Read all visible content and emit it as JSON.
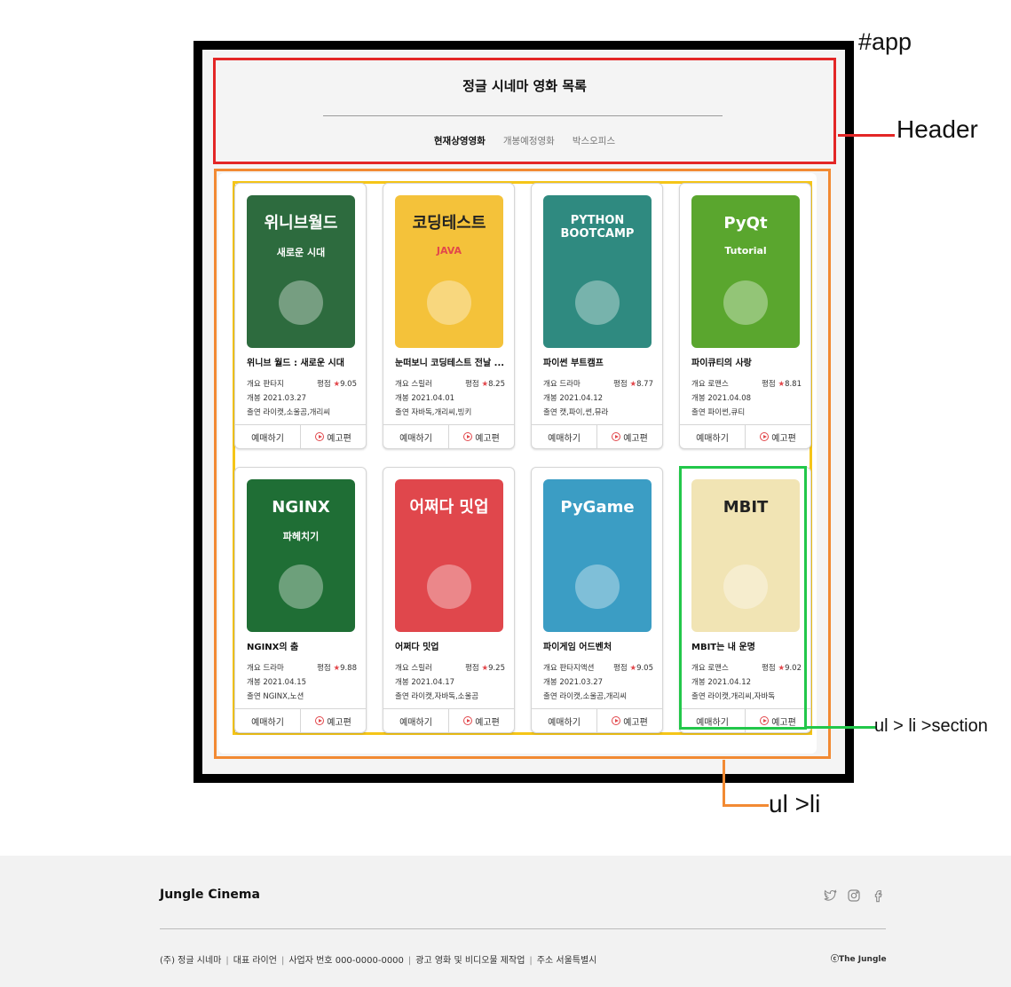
{
  "annotations": {
    "app_label": "#app",
    "header_label": "Header",
    "li_label": "ul >li",
    "section_label": "ul > li >section"
  },
  "header": {
    "title": "정글 시네마 영화 목록",
    "tabs": [
      {
        "label": "현재상영영화",
        "active": true
      },
      {
        "label": "개봉예정영화",
        "active": false
      },
      {
        "label": "박스오피스",
        "active": false
      }
    ]
  },
  "labels": {
    "genre": "개요",
    "rating": "평점",
    "release": "개봉",
    "cast": "출연",
    "reserve_button": "예매하기",
    "trailer_button": "예고편",
    "star": "★"
  },
  "movies": [
    {
      "title": "위니브 월드 : 새로운 시대",
      "genre": "판타지",
      "rating": "9.05",
      "release": "2021.03.27",
      "cast": "라이캣,소울곰,개리씨",
      "poster_text": "위니브월드",
      "poster_sub": "새로운 시대",
      "poster_color": "#2d6b3e"
    },
    {
      "title": "눈떠보니 코딩테스트 전날 ...",
      "genre": "스릴러",
      "rating": "8.25",
      "release": "2021.04.01",
      "cast": "자바독,개리씨,빙키",
      "poster_text": "코딩테스트",
      "poster_sub": "JAVA",
      "poster_color": "#f4c23a"
    },
    {
      "title": "파이썬 부트캠프",
      "genre": "드라마",
      "rating": "8.77",
      "release": "2021.04.12",
      "cast": "캣,파이,썬,뮤라",
      "poster_text": "PYTHON BOOTCAMP",
      "poster_sub": "",
      "poster_color": "#2f8a80"
    },
    {
      "title": "파이큐티의 사랑",
      "genre": "로맨스",
      "rating": "8.81",
      "release": "2021.04.08",
      "cast": "파이썬,큐티",
      "poster_text": "PyQt",
      "poster_sub": "Tutorial",
      "poster_color": "#5aa62e"
    },
    {
      "title": "NGINX의 춤",
      "genre": "드라마",
      "rating": "9.88",
      "release": "2021.04.15",
      "cast": "NGINX,노션",
      "poster_text": "NGINX",
      "poster_sub": "파헤치기",
      "poster_color": "#1f6e35"
    },
    {
      "title": "어쩌다 밋업",
      "genre": "스릴러",
      "rating": "9.25",
      "release": "2021.04.17",
      "cast": "라이캣,자바독,소울곰",
      "poster_text": "어쩌다 밋업",
      "poster_sub": "",
      "poster_color": "#e0474c"
    },
    {
      "title": "파이게임 어드벤처",
      "genre": "판타지액션",
      "rating": "9.05",
      "release": "2021.03.27",
      "cast": "라이캣,소울곰,개리씨",
      "poster_text": "PyGame",
      "poster_sub": "",
      "poster_color": "#3b9dc4"
    },
    {
      "title": "MBIT는 내 운명",
      "genre": "로맨스",
      "rating": "9.02",
      "release": "2021.04.12",
      "cast": "라이캣,개리씨,자바독",
      "poster_text": "MBIT",
      "poster_sub": "",
      "poster_color": "#f1e4b4"
    }
  ],
  "footer": {
    "brand": "Jungle Cinema",
    "company": "(주) 정글 시네마",
    "ceo_label": "대표",
    "ceo": "라이언",
    "biz_label": "사업자 번호",
    "biz_no": "000-0000-0000",
    "desc": "광고 영화 및 비디오물 제작업",
    "addr_label": "주소",
    "addr": "서울특별시",
    "copyright": "ⓒThe Jungle",
    "social": [
      "twitter-icon",
      "instagram-icon",
      "facebook-icon"
    ]
  }
}
